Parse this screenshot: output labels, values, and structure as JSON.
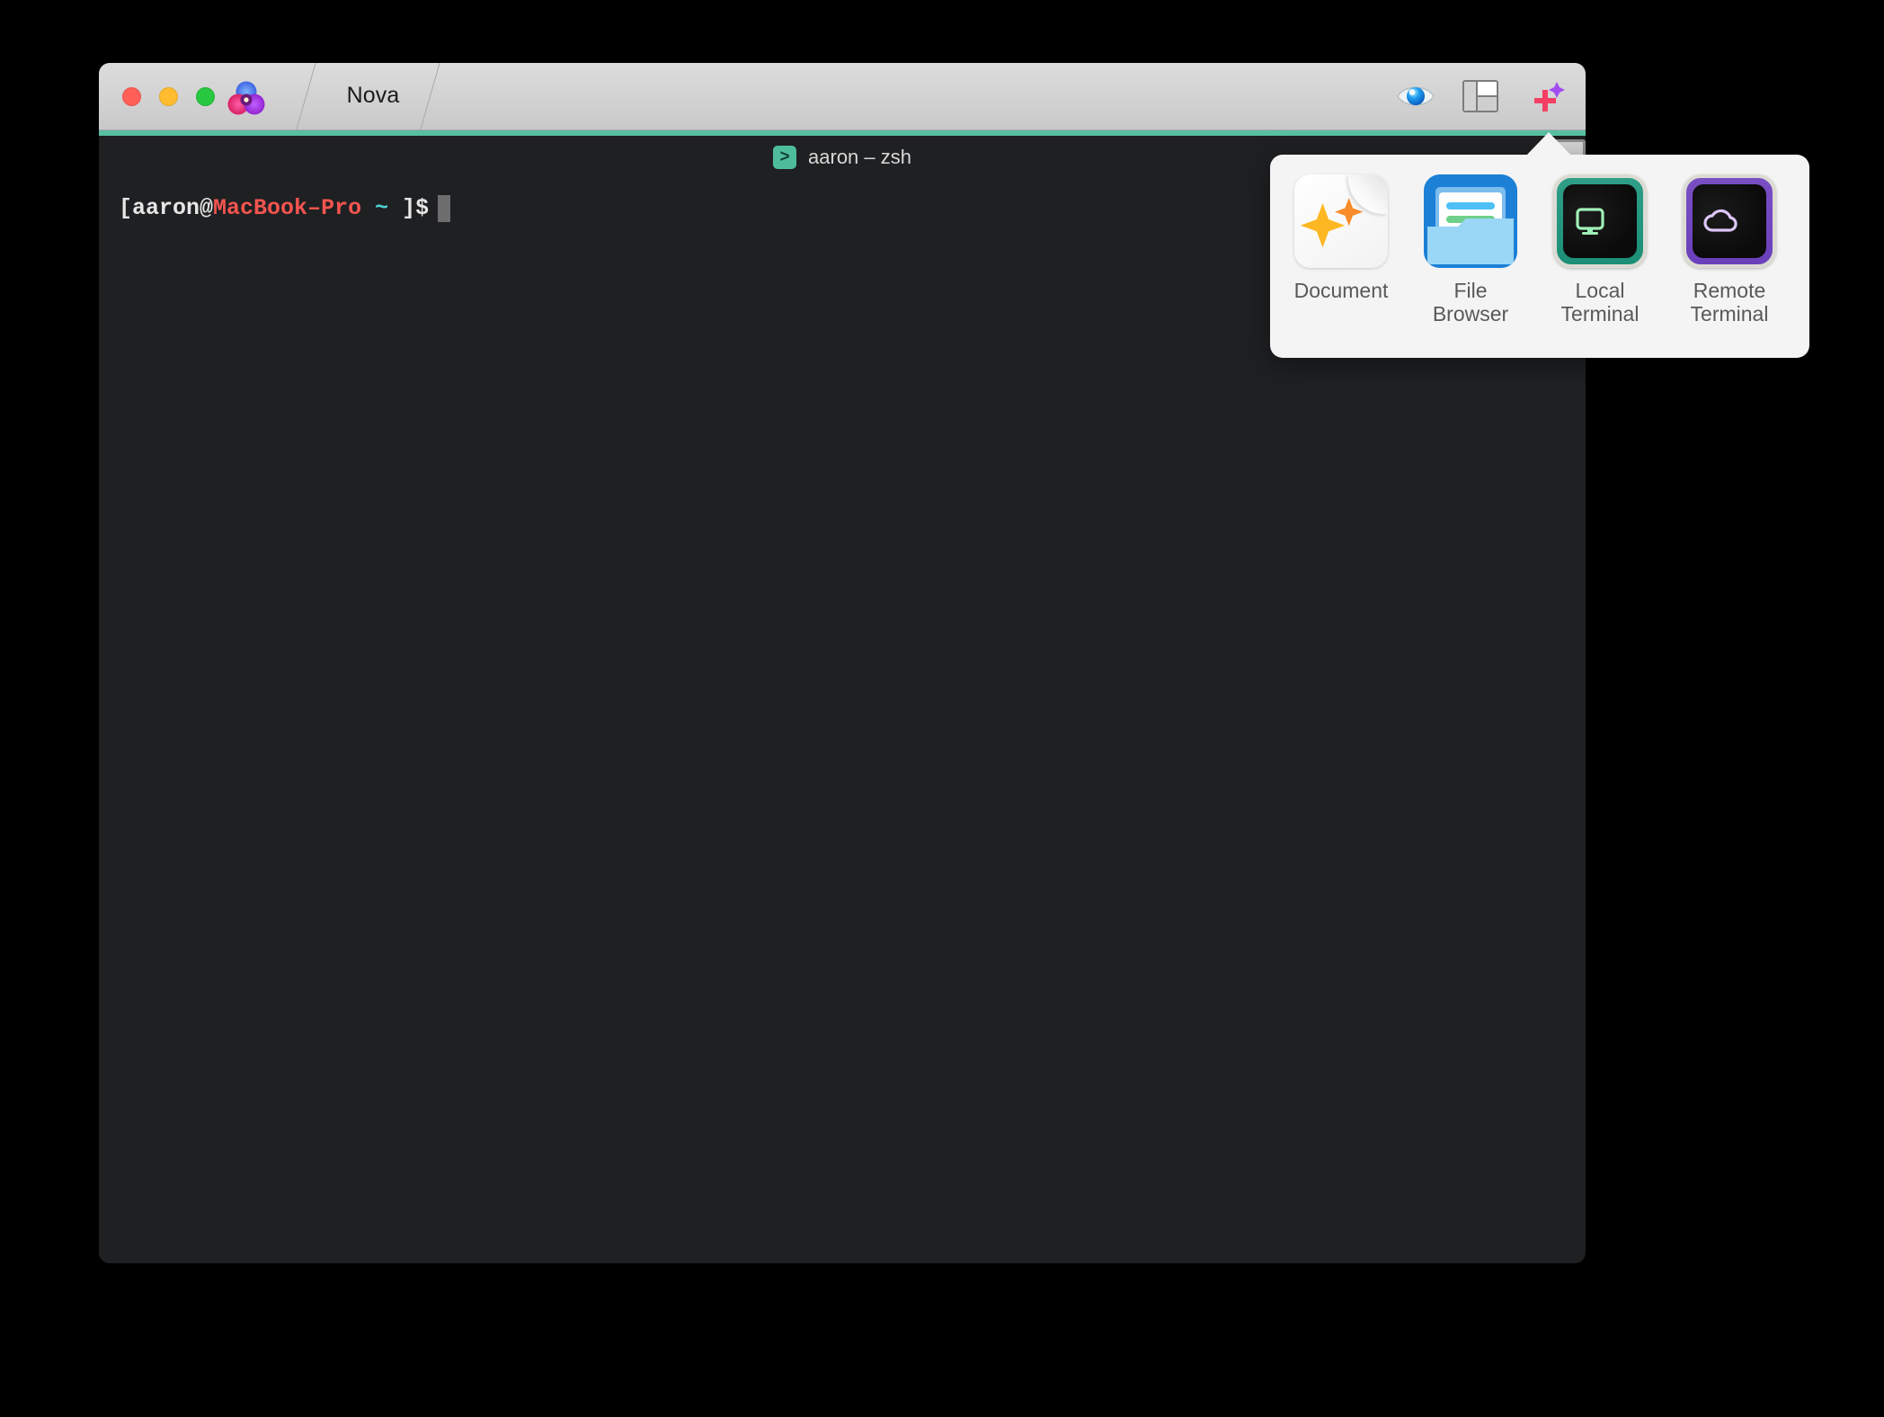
{
  "window": {
    "app_title": "Nova",
    "traffic_lights": [
      {
        "name": "close",
        "color": "#ff5f57"
      },
      {
        "name": "minimize",
        "color": "#febc2e"
      },
      {
        "name": "zoom",
        "color": "#28c840"
      }
    ],
    "accent_color": "#58c0a0"
  },
  "toolbar": {
    "items": [
      {
        "name": "preview-eye",
        "icon": "eye-icon",
        "label": "Preview"
      },
      {
        "name": "split-pane",
        "icon": "split-pane-icon",
        "label": "Split Pane"
      },
      {
        "name": "new-item",
        "icon": "plus-sparkle-icon",
        "label": "New"
      }
    ]
  },
  "terminal": {
    "tab": {
      "icon": "prompt-chevron-icon",
      "icon_glyph": ">",
      "label": "aaron – zsh"
    },
    "prompt": {
      "bracket_open": "[",
      "user": "aaron",
      "at": "@",
      "host": "MacBook–Pro",
      "path": "~",
      "bracket_close": "]",
      "sigil": "$"
    },
    "colors": {
      "background": "#1f2022",
      "user": "#e6e6e6",
      "host": "#f4544f",
      "path": "#4fd6d2",
      "cursor": "#6d6d6d"
    }
  },
  "popover": {
    "items": [
      {
        "name": "document",
        "label": "Document",
        "icon": "document-sparkle-icon"
      },
      {
        "name": "file-browser",
        "label": "File\nBrowser",
        "icon": "folder-icon"
      },
      {
        "name": "local-terminal",
        "label": "Local\nTerminal",
        "icon": "local-terminal-icon"
      },
      {
        "name": "remote-terminal",
        "label": "Remote\nTerminal",
        "icon": "remote-terminal-icon"
      }
    ]
  }
}
